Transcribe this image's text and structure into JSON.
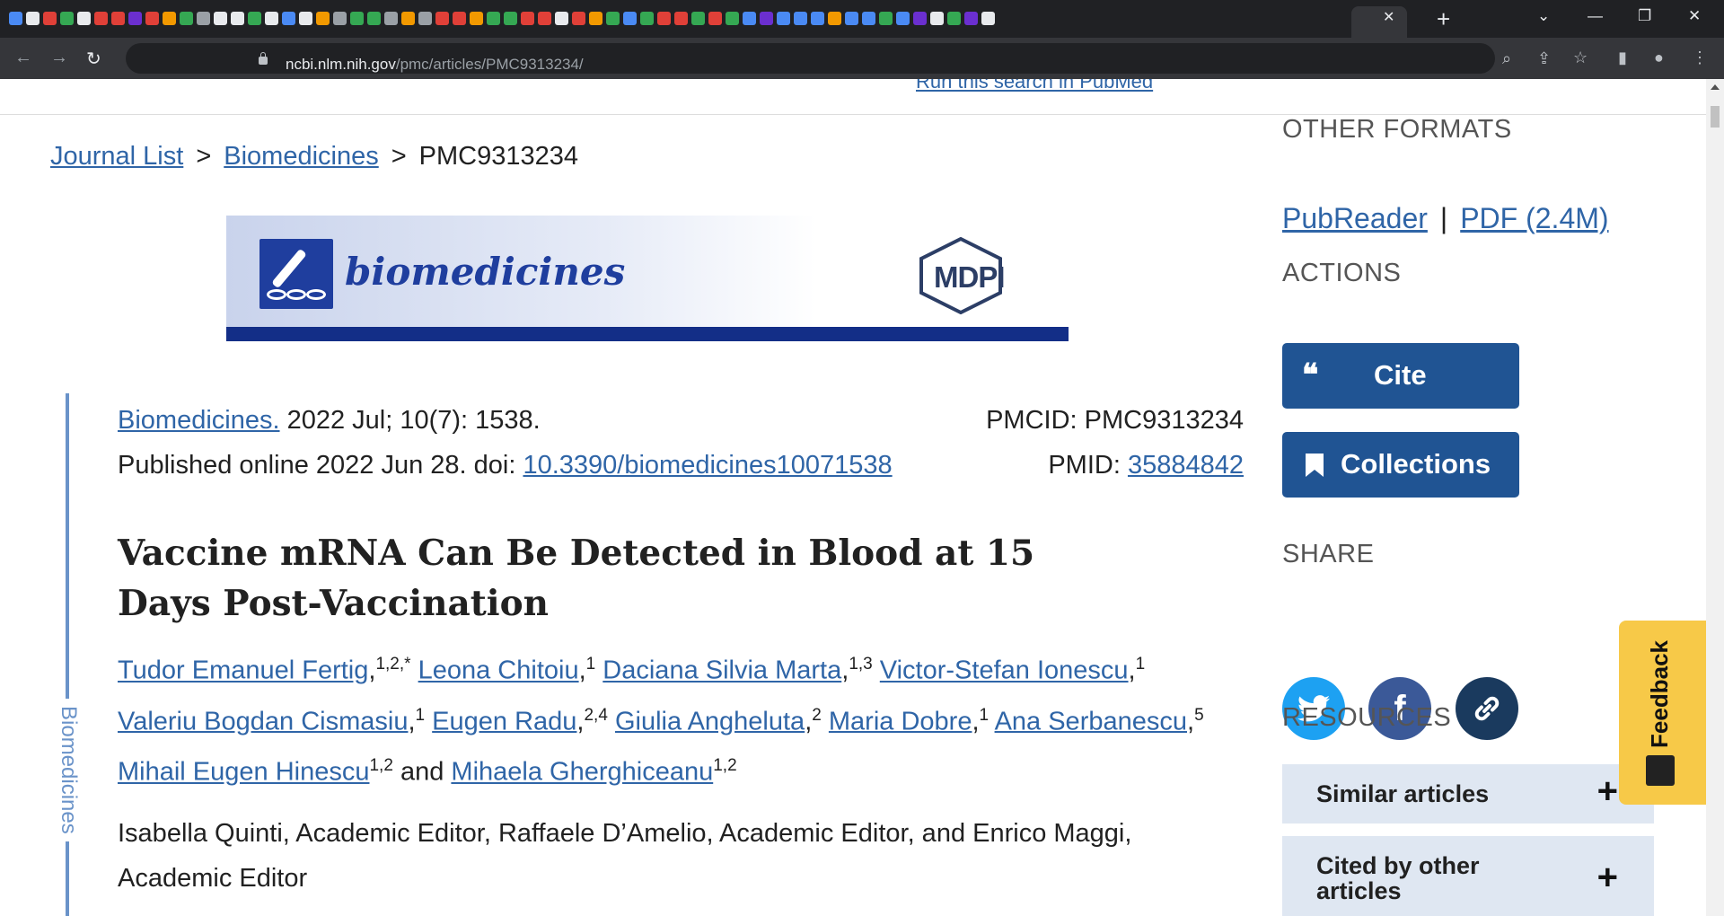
{
  "browser": {
    "url_host": "ncbi.nlm.nih.gov",
    "url_path": "/pmc/articles/PMC9313234/",
    "tab_close": "✕",
    "new_tab": "+",
    "controls": {
      "minimize": "—",
      "restore": "❐",
      "close": "✕"
    },
    "tab_colors": [
      "#4a8af4",
      "#e8eaed",
      "#e04038",
      "#35a853",
      "#e8eaed",
      "#e04038",
      "#e04038",
      "#6b2fd0",
      "#e04038",
      "#f29900",
      "#35a853",
      "#9aa0a6",
      "#e8eaed",
      "#e8eaed",
      "#35a853",
      "#e8eaed",
      "#4a8af4",
      "#e8eaed",
      "#f29900",
      "#9aa0a6",
      "#35a853",
      "#35a853",
      "#9aa0a6",
      "#f29900",
      "#9aa0a6",
      "#e04038",
      "#e04038",
      "#f29900",
      "#35a853",
      "#35a853",
      "#e04038",
      "#e04038",
      "#e8eaed",
      "#e04038",
      "#f29900",
      "#35a853",
      "#4a8af4",
      "#35a853",
      "#e04038",
      "#e04038",
      "#35a853",
      "#e04038",
      "#35a853",
      "#4a8af4",
      "#6b2fd0",
      "#4a8af4",
      "#4a8af4",
      "#4a8af4",
      "#f29900",
      "#4a8af4",
      "#4a8af4",
      "#35a853",
      "#4a8af4",
      "#6b2fd0",
      "#e8eaed",
      "#35a853",
      "#6b2fd0",
      "#e8eaed"
    ]
  },
  "page": {
    "run_search": "Run this search in PubMed",
    "breadcrumb": {
      "journal_list": "Journal List",
      "journal": "Biomedicines",
      "sep": ">",
      "current": "PMC9313234"
    },
    "banner": {
      "title": "biomedicines",
      "publisher": "MDPI"
    },
    "side_label": "Biomedicines",
    "citation": {
      "journal_link": "Biomedicines.",
      "issue": " 2022 Jul; 10(7): 1538.",
      "published_prefix": "Published online 2022 Jun 28. doi: ",
      "doi": "10.3390/biomedicines10071538",
      "pmcid": "PMCID: PMC9313234",
      "pmid_label": "PMID: ",
      "pmid": "35884842"
    },
    "title": "Vaccine mRNA Can Be Detected in Blood at 15 Days Post-Vaccination",
    "authors": [
      {
        "name": "Tudor Emanuel Fertig",
        "sup": "1,2,*",
        "after": ","
      },
      {
        "name": "Leona Chitoiu",
        "sup": "1",
        "after": ","
      },
      {
        "name": "Daciana Silvia Marta",
        "sup": "1,3",
        "after": ","
      },
      {
        "name": "Victor-Stefan Ionescu",
        "sup": "1",
        "after": ","
      },
      {
        "name": "Valeriu Bogdan Cismasiu",
        "sup": "1",
        "after": ","
      },
      {
        "name": "Eugen Radu",
        "sup": "2,4",
        "after": ","
      },
      {
        "name": "Giulia Angheluta",
        "sup": "2",
        "after": ","
      },
      {
        "name": "Maria Dobre",
        "sup": "1",
        "after": ","
      },
      {
        "name": "Ana Serbanescu",
        "sup": "5",
        "after": ","
      },
      {
        "name": "Mihail Eugen Hinescu",
        "sup": "1,2",
        "after": " and"
      },
      {
        "name": "Mihaela Gherghiceanu",
        "sup": "1,2",
        "after": ""
      }
    ],
    "editors": "Isabella Quinti, Academic Editor, Raffaele D’Amelio, Academic Editor, and Enrico Maggi, Academic Editor"
  },
  "sidebar": {
    "other_formats": "OTHER FORMATS",
    "pubreader": "PubReader",
    "pipe": "|",
    "pdf": "PDF (2.4M)",
    "actions": "ACTIONS",
    "cite": "Cite",
    "collections": "Collections",
    "share": "SHARE",
    "resources": "RESOURCES",
    "similar": "Similar articles",
    "cited_by": "Cited by other articles",
    "plus": "+"
  },
  "feedback": "Feedback",
  "colors": {
    "accent": "#205493",
    "link": "#2f65a7",
    "twitter": "#1da1f2",
    "facebook": "#3b5998",
    "copylink": "#1a3a5e",
    "feedback": "#f7c948"
  }
}
